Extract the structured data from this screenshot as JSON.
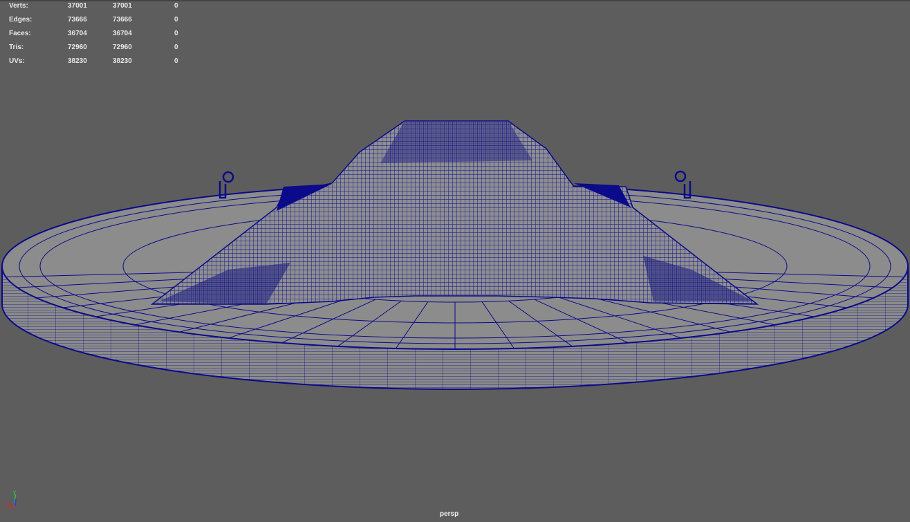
{
  "hud": {
    "rows": [
      {
        "label": "Verts:",
        "total": "37001",
        "selected": "37001",
        "other": "0"
      },
      {
        "label": "Edges:",
        "total": "73666",
        "selected": "73666",
        "other": "0"
      },
      {
        "label": "Faces:",
        "total": "36704",
        "selected": "36704",
        "other": "0"
      },
      {
        "label": "Tris:",
        "total": "72960",
        "selected": "72960",
        "other": "0"
      },
      {
        "label": "UVs:",
        "total": "38230",
        "selected": "38230",
        "other": "0"
      }
    ]
  },
  "viewport": {
    "camera_label": "persp",
    "wire_color": "#0a0a8a",
    "background": "#5d5d5d",
    "axis": {
      "x": "x",
      "y": "y"
    }
  }
}
